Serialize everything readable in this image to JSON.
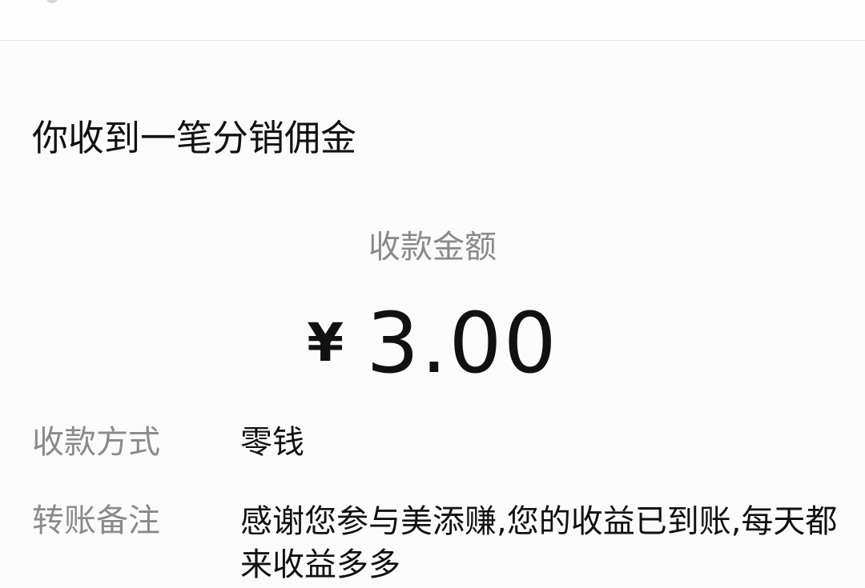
{
  "notification": {
    "title": "你收到一笔分销佣金",
    "amount_label": "收款金额",
    "currency_symbol": "¥",
    "amount": "3.00"
  },
  "details": {
    "payment_method_label": "收款方式",
    "payment_method_value": "零钱",
    "transfer_note_label": "转账备注",
    "transfer_note_value": "感谢您参与美添赚,您的收益已到账,每天都来收益多多"
  },
  "colors": {
    "background": "#fbfbfb",
    "primary_text": "#111111",
    "secondary_text": "#8a8a8a",
    "divider": "#e6e6e6"
  }
}
